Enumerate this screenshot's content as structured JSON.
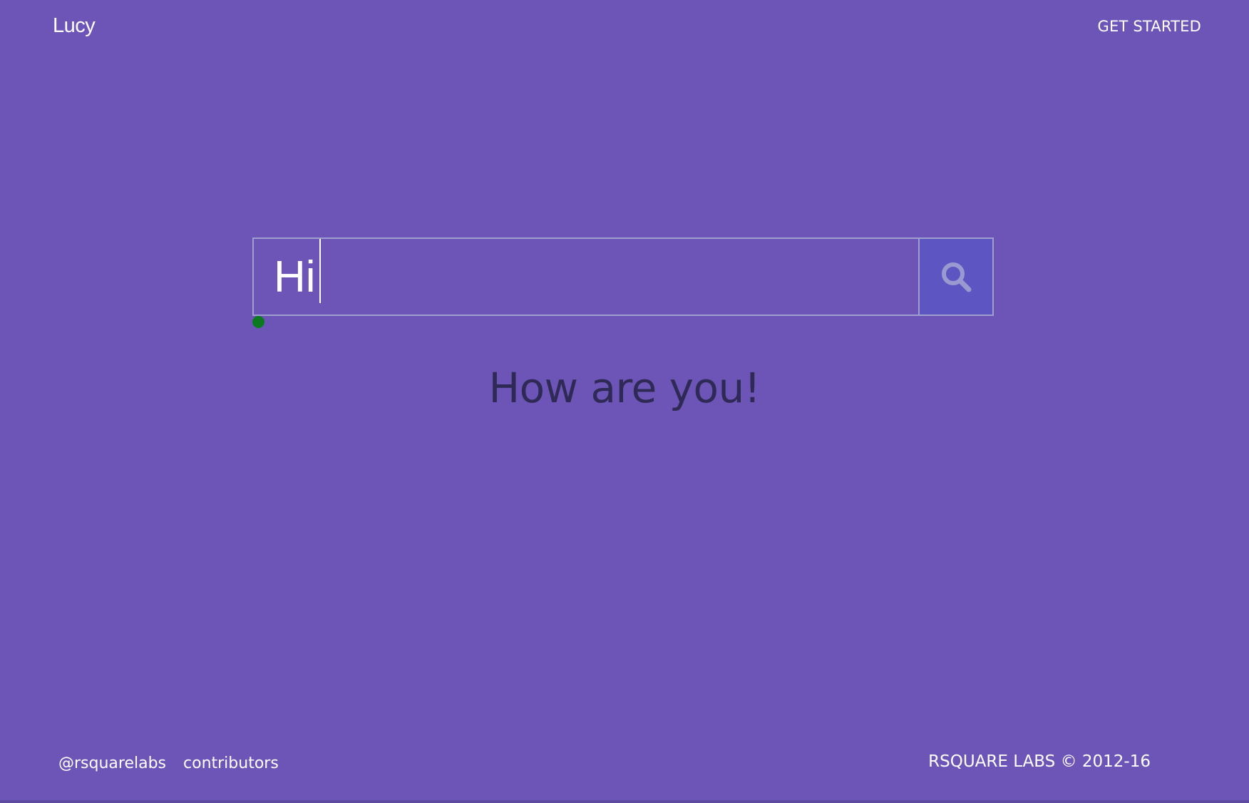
{
  "header": {
    "brand": "Lucy",
    "nav_link": "GET STARTED"
  },
  "search": {
    "value": "Hi",
    "button_icon": "search-icon"
  },
  "response": {
    "text": "How are you!"
  },
  "footer": {
    "links": [
      "@rsquarelabs",
      "contributors"
    ],
    "copyright": "RSQUARE LABS © 2012-16"
  },
  "colors": {
    "background": "#6d55b8",
    "search_button": "#5c55c2",
    "input_border": "#9f9fcf",
    "response_text": "#2f2a55",
    "status_dot": "#0b7a1f"
  }
}
